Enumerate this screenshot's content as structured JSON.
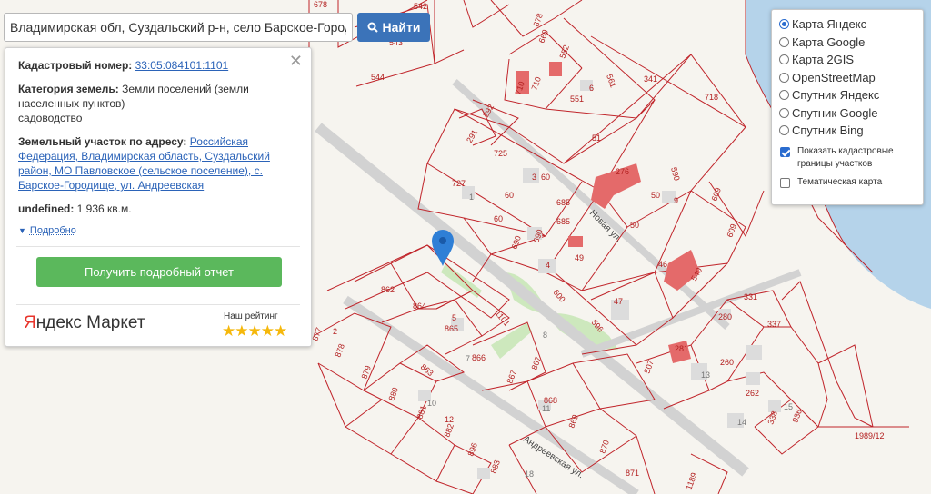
{
  "search": {
    "value": "Владимирская обл, Суздальский р-н, село Барское-Городи",
    "button_label": "Найти",
    "button_icon": "search-icon"
  },
  "info": {
    "cadastral_label": "Кадастровый номер:",
    "cadastral_number": "33:05:084101:1101",
    "category_label": "Категория земель:",
    "category_value": "Земли поселений (земли населенных пунктов)",
    "usage": "садоводство",
    "address_label": "Земельный участок по адресу:",
    "address_value": "Российская Федерация, Владимирская область, Суздальский район, МО Павловское (сельское поселение), с. Барское-Городище, ул. Андреевская",
    "area_label": "undefined:",
    "area_value": "1 936 кв.м.",
    "more_label": "Подробно",
    "report_button": "Получить подробный отчет",
    "ad_brand_first": "Я",
    "ad_brand_rest": "ндекс Маркет",
    "rating_label": "Наш рейтинг",
    "stars": 5
  },
  "layers": {
    "options": [
      "Карта Яндекс",
      "Карта Google",
      "Карта 2GIS",
      "OpenStreetMap",
      "Спутник Яндекс",
      "Спутник Google",
      "Спутник Bing"
    ],
    "selected": "Карта Яндекс",
    "checkboxes": [
      {
        "label": "Показать кадастровые границы участков",
        "checked": true
      },
      {
        "label": "Тематическая карта",
        "checked": false
      }
    ]
  },
  "map": {
    "colors": {
      "boundary": "#c0242a",
      "house": "#e46a6a",
      "water": "#b5d3ea",
      "green": "#cde8bd",
      "pin": "#2f7fd6"
    },
    "street_labels": [
      "Андреевская ул.",
      "Новая ул."
    ],
    "parcel_labels": [
      "542",
      "543",
      "544",
      "678",
      "878",
      "660",
      "552",
      "710",
      "710",
      "561",
      "341",
      "718",
      "292",
      "551",
      "291",
      "725",
      "51",
      "727",
      "60",
      "60",
      "276",
      "590",
      "609",
      "685",
      "685",
      "50",
      "50",
      "609",
      "60",
      "690",
      "690",
      "49",
      "46",
      "540",
      "4",
      "862",
      "864",
      "600",
      "47",
      "596",
      "331",
      "337",
      "1101",
      "865",
      "280",
      "866",
      "281",
      "877",
      "2",
      "878",
      "879",
      "863",
      "507",
      "260",
      "867",
      "867",
      "868",
      "262",
      "880",
      "881",
      "869",
      "338",
      "936",
      "882",
      "12",
      "896",
      "870",
      "883",
      "871",
      "1189",
      "1989/12",
      "5",
      "6",
      "3",
      "9",
      "13",
      "14",
      "15",
      "10",
      "11",
      "18",
      "7",
      "8",
      "1"
    ],
    "street_name_1": "Андреевская ул.",
    "street_name_2": "Новая ул."
  }
}
